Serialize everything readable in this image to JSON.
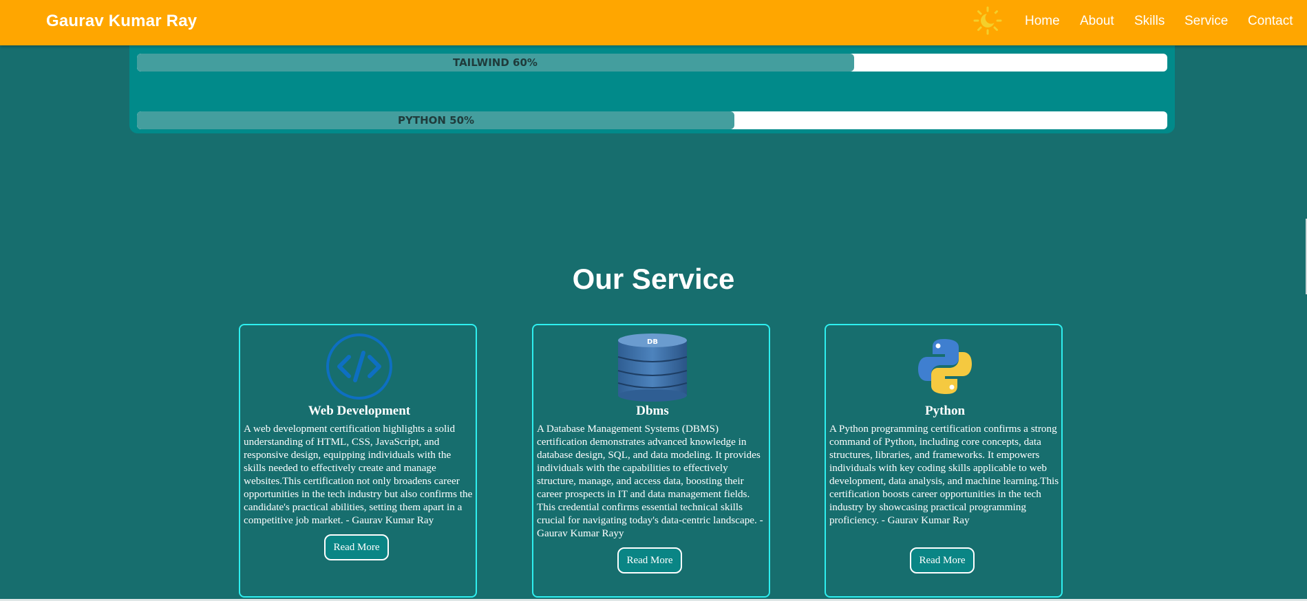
{
  "header": {
    "brand": "Gaurav Kumar Ray",
    "theme_icon": "sun-moon-icon",
    "accent": "#ffa600",
    "nav": [
      {
        "label": "Home"
      },
      {
        "label": "About"
      },
      {
        "label": "Skills"
      },
      {
        "label": "Service"
      },
      {
        "label": "Contact"
      }
    ]
  },
  "skills": [
    {
      "label": "TAILWIND 60%",
      "fraction": 0.6
    },
    {
      "label": "PYTHON 50%",
      "fraction": 0.5
    }
  ],
  "services": {
    "title": "Our Service",
    "cards": [
      {
        "icon": "code-icon",
        "title": "Web Development",
        "desc": "A web development certification highlights a solid understanding of HTML, CSS, JavaScript, and responsive design, equipping individuals with the skills needed to effectively create and manage websites.This certification not only broadens career opportunities in the tech industry but also confirms the candidate's practical abilities, setting them apart in a competitive job market. - Gaurav Kumar Ray",
        "button": "Read More"
      },
      {
        "icon": "database-icon",
        "icon_text": "DB",
        "title": "Dbms",
        "desc": "A Database Management Systems (DBMS) certification demonstrates advanced knowledge in database design, SQL, and data modeling. It provides individuals with the capabilities to effectively structure, manage, and access data, boosting their career prospects in IT and data management fields. This credential confirms essential technical skills crucial for navigating today's data-centric landscape. - Gaurav Kumar Rayy",
        "button": "Read More"
      },
      {
        "icon": "python-logo-icon",
        "title": "Python",
        "desc": "A Python programming certification confirms a strong command of Python, including core concepts, data structures, libraries, and frameworks. It empowers individuals with key coding skills applicable to web development, data analysis, and machine learning.This certification boosts career opportunities in the tech industry by showcasing practical programming proficiency. - Gaurav Kumar Ray",
        "button": "Read More"
      }
    ]
  }
}
